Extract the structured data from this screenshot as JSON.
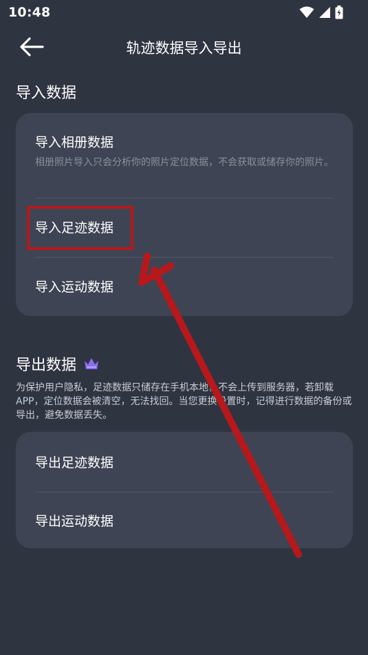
{
  "status_bar": {
    "time": "10:48",
    "icons": [
      "wifi-icon",
      "cellular-signal-icon",
      "battery-charging-icon"
    ]
  },
  "header": {
    "back_icon": "arrow-left-icon",
    "title": "轨迹数据导入导出"
  },
  "import_section": {
    "heading": "导入数据",
    "items": [
      {
        "label": "导入相册数据",
        "description": "相册照片导入只会分析你的照片定位数据，不会获取或储存你的照片。"
      },
      {
        "label": "导入足迹数据"
      },
      {
        "label": "导入运动数据"
      }
    ]
  },
  "export_section": {
    "heading": "导出数据",
    "badge_icon": "crown-icon",
    "notice": "为保护用户隐私，足迹数据只储存在手机本地，不会上传到服务器，若卸载APP，定位数据会被清空，无法找回。当您更换设置时，记得进行数据的备份或导出，避免数据丢失。",
    "items": [
      {
        "label": "导出足迹数据"
      },
      {
        "label": "导出运动数据"
      }
    ]
  },
  "colors": {
    "background": "#2f3441",
    "card": "#3e4453",
    "annotation_red": "#b8181b",
    "crown_purple": "#8b6cf0"
  }
}
